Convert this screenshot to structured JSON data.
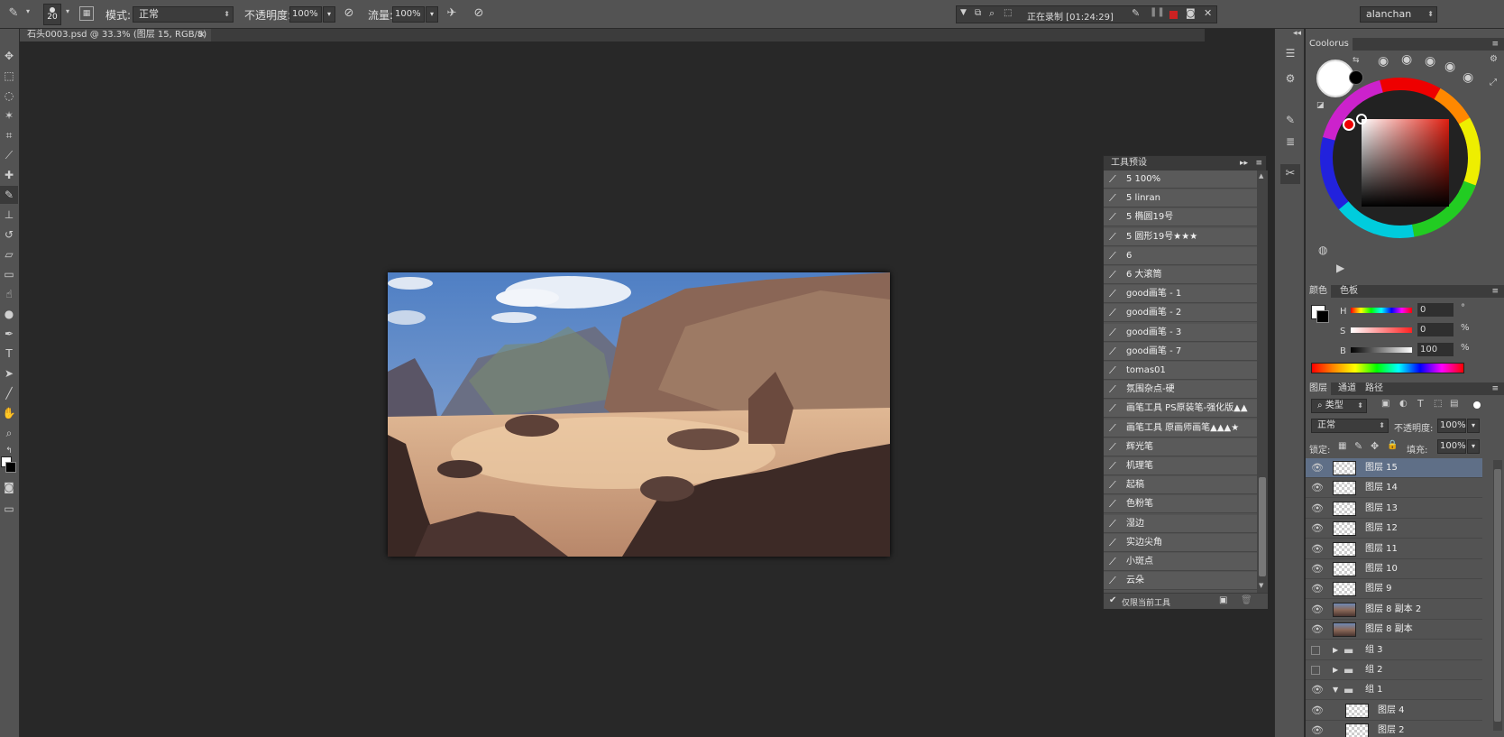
{
  "options_bar": {
    "brush_size": "20",
    "mode_label": "模式:",
    "mode_value": "正常",
    "opacity_label": "不透明度:",
    "opacity_value": "100%",
    "flow_label": "流量:",
    "flow_value": "100%",
    "recording_text": "正在录制 [01:24:29]",
    "user": "alanchan"
  },
  "document": {
    "tab_title": "石头0003.psd @ 33.3% (图层 15, RGB/8) *",
    "close": "×"
  },
  "tool_presets": {
    "title": "工具预设",
    "items": [
      "5 100%",
      "5 linran",
      "5 椭圆19号",
      "5 圆形19号★★★",
      "6",
      "6 大滚筒",
      "good画笔 - 1",
      "good画笔 - 2",
      "good画笔 - 3",
      "good画笔 - 7",
      "tomas01",
      "氛围杂点-硬",
      "画笔工具 PS原装笔-强化版▲▲",
      "画笔工具 原画师画笔▲▲▲★",
      "辉光笔",
      "机理笔",
      "起稿",
      "色粉笔",
      "湿边",
      "实边尖角",
      "小斑点",
      "云朵"
    ],
    "footer_label": "仅限当前工具"
  },
  "coolorus": {
    "title": "Coolorus"
  },
  "color_panel": {
    "tabs": [
      "颜色",
      "色板"
    ],
    "h_label": "H",
    "h_value": "0",
    "h_unit": "°",
    "s_label": "S",
    "s_value": "0",
    "s_unit": "%",
    "b_label": "B",
    "b_value": "100",
    "b_unit": "%"
  },
  "layers_panel": {
    "tabs": [
      "图层",
      "通道",
      "路径"
    ],
    "filter_label": "类型",
    "blend_mode": "正常",
    "opacity_label": "不透明度:",
    "opacity_value": "100%",
    "lock_label": "锁定:",
    "fill_label": "填充:",
    "fill_value": "100%",
    "layers": [
      {
        "name": "图层 15",
        "thumb": "blank",
        "visible": true,
        "selected": true,
        "indent": 0
      },
      {
        "name": "图层 14",
        "thumb": "blank",
        "visible": true,
        "indent": 0
      },
      {
        "name": "图层 13",
        "thumb": "blank",
        "visible": true,
        "indent": 0
      },
      {
        "name": "图层 12",
        "thumb": "blank",
        "visible": true,
        "indent": 0
      },
      {
        "name": "图层 11",
        "thumb": "blank",
        "visible": true,
        "indent": 0
      },
      {
        "name": "图层 10",
        "thumb": "blank",
        "visible": true,
        "indent": 0
      },
      {
        "name": "图层 9",
        "thumb": "blank",
        "visible": true,
        "indent": 0
      },
      {
        "name": "图层 8 副本 2",
        "thumb": "image",
        "visible": true,
        "indent": 0
      },
      {
        "name": "图层 8 副本",
        "thumb": "image",
        "visible": true,
        "indent": 0
      },
      {
        "name": "组 3",
        "thumb": "folder",
        "visible": false,
        "collapsed": true,
        "indent": 0
      },
      {
        "name": "组 2",
        "thumb": "folder",
        "visible": false,
        "collapsed": true,
        "indent": 0
      },
      {
        "name": "组 1",
        "thumb": "folder",
        "visible": true,
        "collapsed": false,
        "indent": 0
      },
      {
        "name": "图层 4",
        "thumb": "blank",
        "visible": true,
        "indent": 1
      },
      {
        "name": "图层 2",
        "thumb": "blank",
        "visible": true,
        "indent": 1
      }
    ]
  },
  "colors": {
    "accent_selected_layer": "#5f6f87",
    "panel_bg": "#535353",
    "canvas_bg": "#282828"
  }
}
